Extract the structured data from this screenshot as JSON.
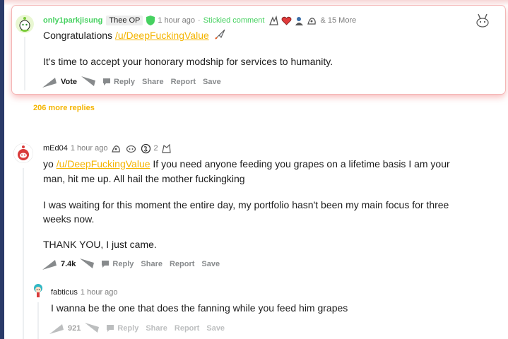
{
  "stickied_comment": {
    "username": "only1parkjisung",
    "flair": "Thee OP",
    "time": "1 hour ago",
    "separator": "·",
    "stickied_label": "Stickied comment",
    "more_awards": "& 15 More",
    "line1_prefix": "Congratulations ",
    "line1_mention": "/u/DeepFuckingValue",
    "line2": "It's time to accept your honorary modship for services to humanity.",
    "vote_label": "Vote",
    "reply_label": "Reply",
    "share_label": "Share",
    "report_label": "Report",
    "save_label": "Save"
  },
  "more_replies_label": "206 more replies",
  "comment2": {
    "username": "mEd04",
    "time": "1 hour ago",
    "award_count": "2",
    "p1_prefix": "yo ",
    "p1_mention": "/u/DeepFuckingValue",
    "p1_rest_line1": " If you need anyone feeding you grapes on a lifetime basis I am your",
    "p1_line2": "man, hit me up. All hail the mother fuckingking",
    "p2_line1": "I was waiting for this moment the entire day, my portfolio hasn't been my main focus for three",
    "p2_line2": "weeks now.",
    "p3": "THANK YOU, I just came.",
    "score": "7.4k",
    "reply_label": "Reply",
    "share_label": "Share",
    "report_label": "Report",
    "save_label": "Save"
  },
  "reply": {
    "username": "fabticus",
    "time": "1 hour ago",
    "text": "I wanna be the one that does the fanning while you feed him grapes",
    "score": "921",
    "reply_label": "Reply",
    "share_label": "Share",
    "report_label": "Report",
    "save_label": "Save"
  },
  "colors": {
    "op_green": "#46d160",
    "mention_gold": "#f4b400",
    "muted": "#878a8c",
    "highlight_shadow": "#f4b6b6"
  },
  "icons": [
    "snoo-avatar-icon",
    "shield-mod-icon",
    "rocket-icon",
    "award-icon",
    "upvote-icon",
    "downvote-icon",
    "comment-icon"
  ]
}
